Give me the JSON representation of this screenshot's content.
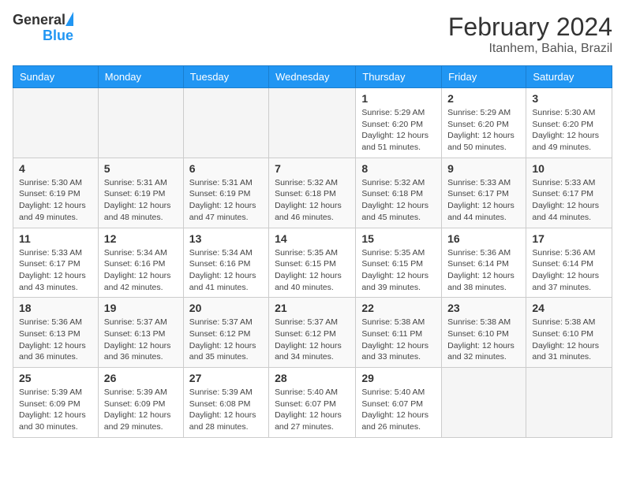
{
  "header": {
    "logo_line1": "General",
    "logo_line2": "Blue",
    "month": "February 2024",
    "location": "Itanhem, Bahia, Brazil"
  },
  "days_of_week": [
    "Sunday",
    "Monday",
    "Tuesday",
    "Wednesday",
    "Thursday",
    "Friday",
    "Saturday"
  ],
  "weeks": [
    {
      "days": [
        {
          "number": "",
          "info": ""
        },
        {
          "number": "",
          "info": ""
        },
        {
          "number": "",
          "info": ""
        },
        {
          "number": "",
          "info": ""
        },
        {
          "number": "1",
          "info": "Sunrise: 5:29 AM\nSunset: 6:20 PM\nDaylight: 12 hours\nand 51 minutes."
        },
        {
          "number": "2",
          "info": "Sunrise: 5:29 AM\nSunset: 6:20 PM\nDaylight: 12 hours\nand 50 minutes."
        },
        {
          "number": "3",
          "info": "Sunrise: 5:30 AM\nSunset: 6:20 PM\nDaylight: 12 hours\nand 49 minutes."
        }
      ]
    },
    {
      "days": [
        {
          "number": "4",
          "info": "Sunrise: 5:30 AM\nSunset: 6:19 PM\nDaylight: 12 hours\nand 49 minutes."
        },
        {
          "number": "5",
          "info": "Sunrise: 5:31 AM\nSunset: 6:19 PM\nDaylight: 12 hours\nand 48 minutes."
        },
        {
          "number": "6",
          "info": "Sunrise: 5:31 AM\nSunset: 6:19 PM\nDaylight: 12 hours\nand 47 minutes."
        },
        {
          "number": "7",
          "info": "Sunrise: 5:32 AM\nSunset: 6:18 PM\nDaylight: 12 hours\nand 46 minutes."
        },
        {
          "number": "8",
          "info": "Sunrise: 5:32 AM\nSunset: 6:18 PM\nDaylight: 12 hours\nand 45 minutes."
        },
        {
          "number": "9",
          "info": "Sunrise: 5:33 AM\nSunset: 6:17 PM\nDaylight: 12 hours\nand 44 minutes."
        },
        {
          "number": "10",
          "info": "Sunrise: 5:33 AM\nSunset: 6:17 PM\nDaylight: 12 hours\nand 44 minutes."
        }
      ]
    },
    {
      "days": [
        {
          "number": "11",
          "info": "Sunrise: 5:33 AM\nSunset: 6:17 PM\nDaylight: 12 hours\nand 43 minutes."
        },
        {
          "number": "12",
          "info": "Sunrise: 5:34 AM\nSunset: 6:16 PM\nDaylight: 12 hours\nand 42 minutes."
        },
        {
          "number": "13",
          "info": "Sunrise: 5:34 AM\nSunset: 6:16 PM\nDaylight: 12 hours\nand 41 minutes."
        },
        {
          "number": "14",
          "info": "Sunrise: 5:35 AM\nSunset: 6:15 PM\nDaylight: 12 hours\nand 40 minutes."
        },
        {
          "number": "15",
          "info": "Sunrise: 5:35 AM\nSunset: 6:15 PM\nDaylight: 12 hours\nand 39 minutes."
        },
        {
          "number": "16",
          "info": "Sunrise: 5:36 AM\nSunset: 6:14 PM\nDaylight: 12 hours\nand 38 minutes."
        },
        {
          "number": "17",
          "info": "Sunrise: 5:36 AM\nSunset: 6:14 PM\nDaylight: 12 hours\nand 37 minutes."
        }
      ]
    },
    {
      "days": [
        {
          "number": "18",
          "info": "Sunrise: 5:36 AM\nSunset: 6:13 PM\nDaylight: 12 hours\nand 36 minutes."
        },
        {
          "number": "19",
          "info": "Sunrise: 5:37 AM\nSunset: 6:13 PM\nDaylight: 12 hours\nand 36 minutes."
        },
        {
          "number": "20",
          "info": "Sunrise: 5:37 AM\nSunset: 6:12 PM\nDaylight: 12 hours\nand 35 minutes."
        },
        {
          "number": "21",
          "info": "Sunrise: 5:37 AM\nSunset: 6:12 PM\nDaylight: 12 hours\nand 34 minutes."
        },
        {
          "number": "22",
          "info": "Sunrise: 5:38 AM\nSunset: 6:11 PM\nDaylight: 12 hours\nand 33 minutes."
        },
        {
          "number": "23",
          "info": "Sunrise: 5:38 AM\nSunset: 6:10 PM\nDaylight: 12 hours\nand 32 minutes."
        },
        {
          "number": "24",
          "info": "Sunrise: 5:38 AM\nSunset: 6:10 PM\nDaylight: 12 hours\nand 31 minutes."
        }
      ]
    },
    {
      "days": [
        {
          "number": "25",
          "info": "Sunrise: 5:39 AM\nSunset: 6:09 PM\nDaylight: 12 hours\nand 30 minutes."
        },
        {
          "number": "26",
          "info": "Sunrise: 5:39 AM\nSunset: 6:09 PM\nDaylight: 12 hours\nand 29 minutes."
        },
        {
          "number": "27",
          "info": "Sunrise: 5:39 AM\nSunset: 6:08 PM\nDaylight: 12 hours\nand 28 minutes."
        },
        {
          "number": "28",
          "info": "Sunrise: 5:40 AM\nSunset: 6:07 PM\nDaylight: 12 hours\nand 27 minutes."
        },
        {
          "number": "29",
          "info": "Sunrise: 5:40 AM\nSunset: 6:07 PM\nDaylight: 12 hours\nand 26 minutes."
        },
        {
          "number": "",
          "info": ""
        },
        {
          "number": "",
          "info": ""
        }
      ]
    }
  ]
}
